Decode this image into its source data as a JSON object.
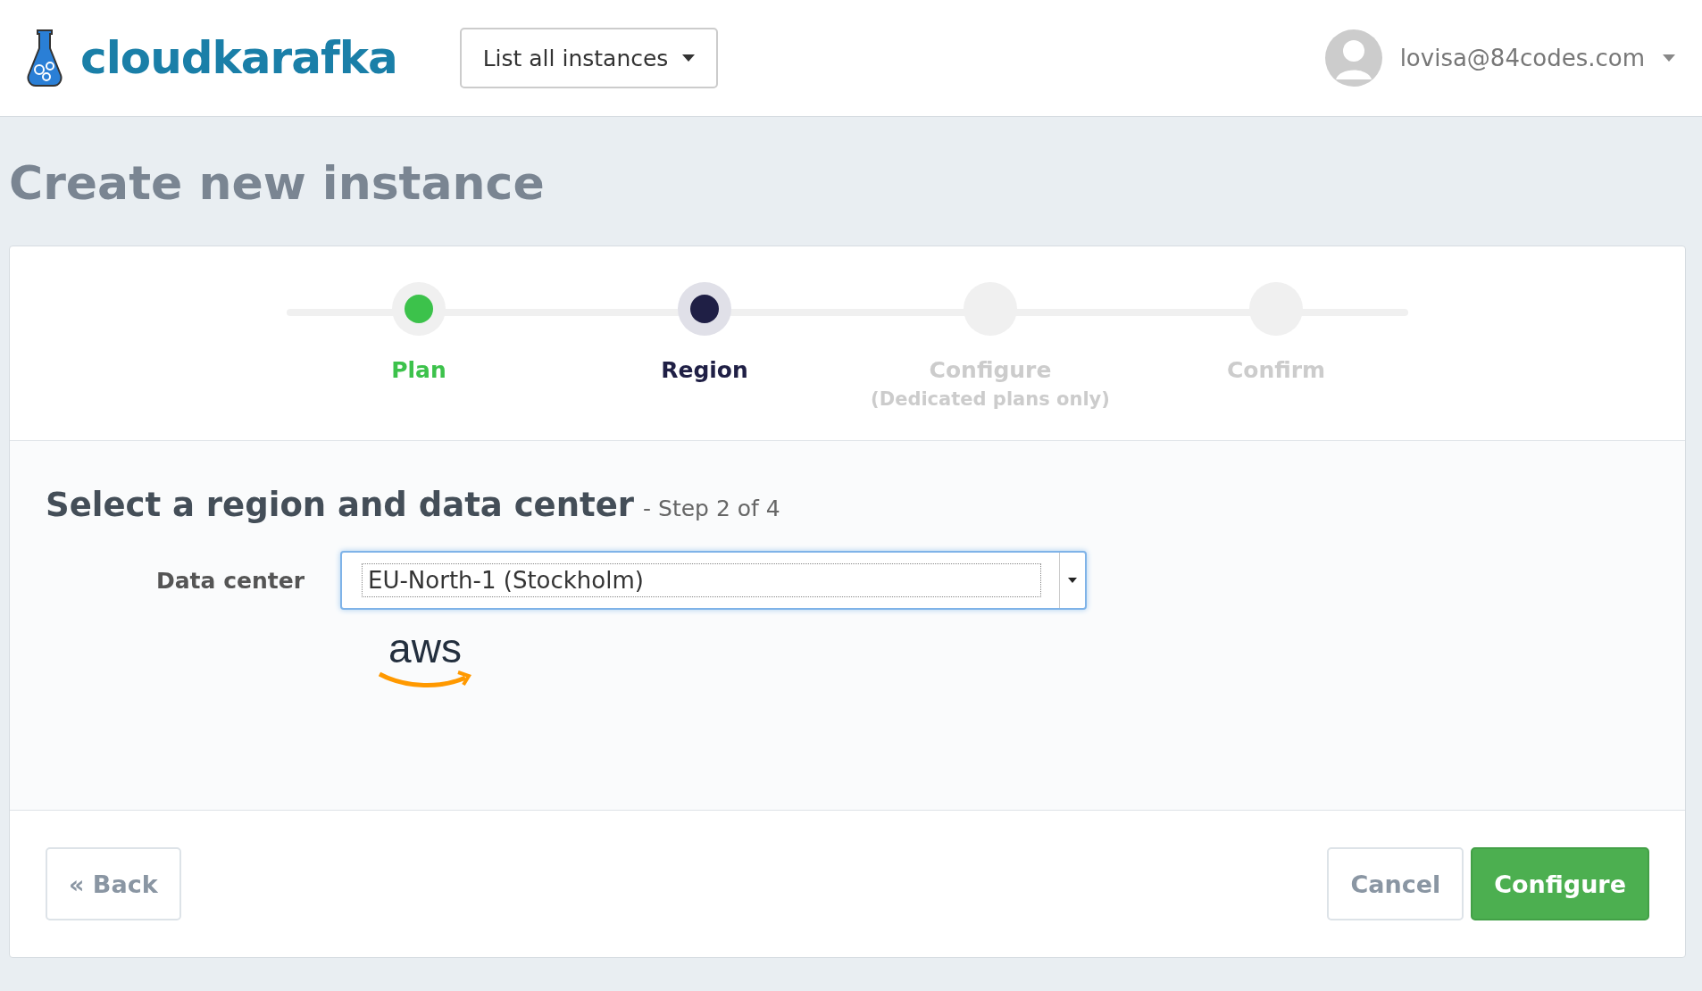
{
  "header": {
    "logo_text": "cloudkarafka",
    "instances_button": "List all instances",
    "user": "lovisa@84codes.com"
  },
  "page_title": "Create new instance",
  "steps": [
    {
      "label": "Plan",
      "completed": true,
      "selected": false
    },
    {
      "label": "Region",
      "completed": false,
      "selected": true
    },
    {
      "label": "Configure",
      "sublabel": "(Dedicated plans only)",
      "completed": false,
      "selected": false
    },
    {
      "label": "Confirm",
      "completed": false,
      "selected": false
    }
  ],
  "section": {
    "title": "Select a region and data center",
    "step_note": "- Step 2 of 4",
    "field_label": "Data center",
    "field_value": "EU-North-1 (Stockholm)",
    "provider_logo_text": "aws"
  },
  "footer": {
    "back": "« Back",
    "cancel": "Cancel",
    "configure": "Configure"
  }
}
